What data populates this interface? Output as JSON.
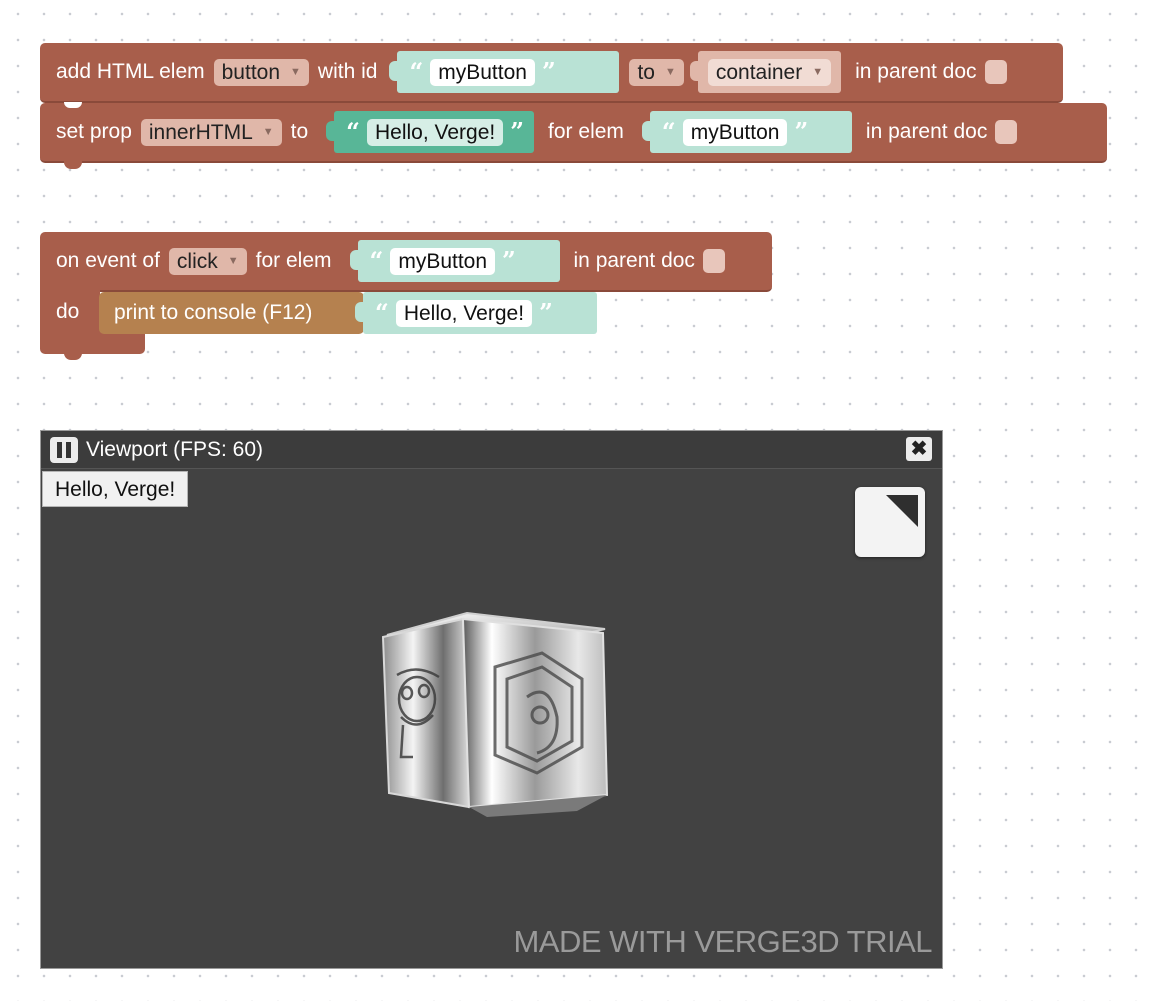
{
  "blocks": {
    "add_html": {
      "label": "add HTML elem",
      "elem_type": "button",
      "with_id_label": "with id",
      "id_value": "myButton",
      "to_label": "to",
      "parent_value": "container",
      "in_parent_doc_label": "in parent doc"
    },
    "set_prop": {
      "label": "set prop",
      "prop": "innerHTML",
      "to_label": "to",
      "value": "Hello, Verge!",
      "for_elem_label": "for elem",
      "elem_value": "myButton",
      "in_parent_doc_label": "in parent doc"
    },
    "on_event": {
      "label": "on event of",
      "event": "click",
      "for_elem_label": "for elem",
      "elem_value": "myButton",
      "in_parent_doc_label": "in parent doc",
      "do_label": "do"
    },
    "print": {
      "label": "print to console (F12)",
      "value": "Hello, Verge!"
    }
  },
  "viewport": {
    "title": "Viewport (FPS: 60)",
    "close_glyph": "✖",
    "button_label": "Hello, Verge!",
    "watermark": "MADE WITH VERGE3D TRIAL"
  },
  "quote_open": "“",
  "quote_close": "”",
  "dropdown_arrow": "▼",
  "colors": {
    "block": "#a85e4b",
    "text_block": "#b9e2d5",
    "text_block_selected": "#58b697",
    "print_block": "#b5814f",
    "viewport_bg": "#424242"
  }
}
